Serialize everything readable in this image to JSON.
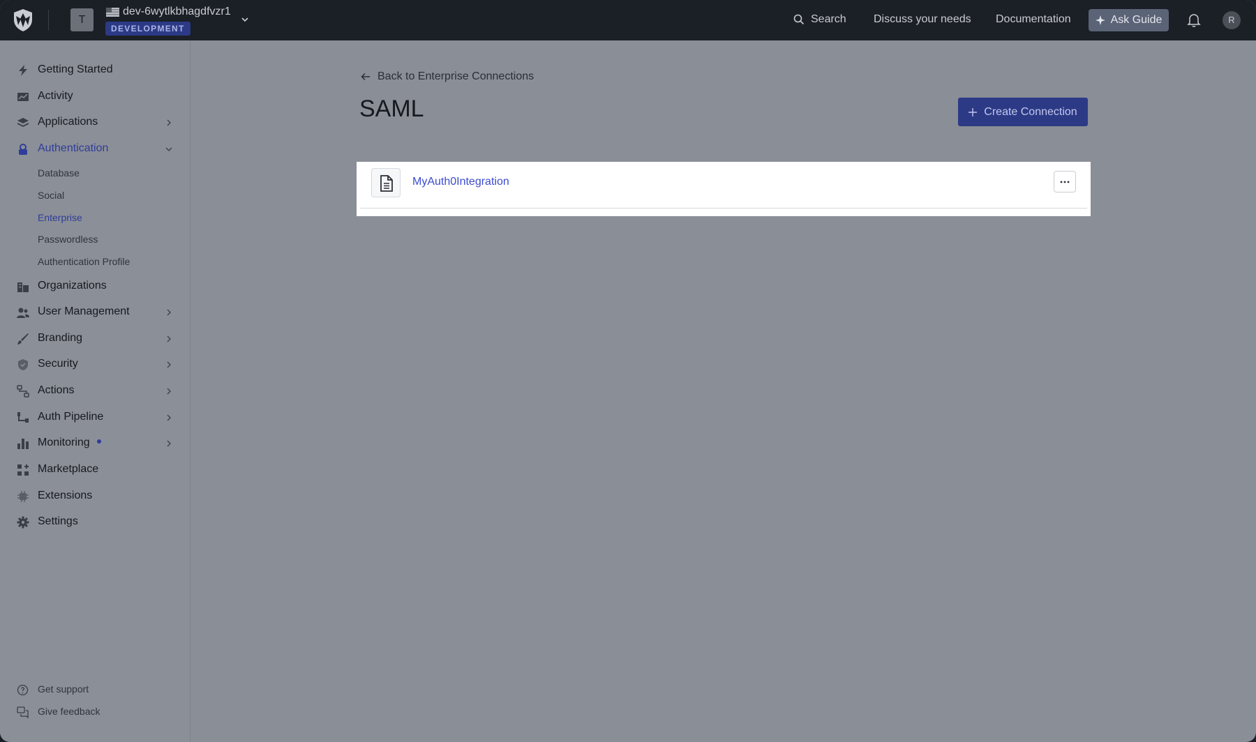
{
  "header": {
    "tenant_initial": "T",
    "tenant_name": "dev-6wytlkbhagdfvzr1",
    "environment_badge": "DEVELOPMENT",
    "search_label": "Search",
    "discuss_label": "Discuss your needs",
    "docs_label": "Documentation",
    "ask_guide_label": "Ask Guide",
    "user_initial": "R"
  },
  "sidebar": {
    "items": [
      {
        "label": "Getting Started",
        "icon": "bolt-icon"
      },
      {
        "label": "Activity",
        "icon": "activity-chart-icon"
      },
      {
        "label": "Applications",
        "icon": "layers-icon"
      },
      {
        "label": "Authentication",
        "icon": "authentication-icon"
      },
      {
        "label": "Organizations",
        "icon": "building-icon"
      },
      {
        "label": "User Management",
        "icon": "users-icon"
      },
      {
        "label": "Branding",
        "icon": "brush-icon"
      },
      {
        "label": "Security",
        "icon": "shield-icon"
      },
      {
        "label": "Actions",
        "icon": "flow-icon"
      },
      {
        "label": "Auth Pipeline",
        "icon": "pipeline-icon"
      },
      {
        "label": "Monitoring",
        "icon": "bar-chart-icon"
      },
      {
        "label": "Marketplace",
        "icon": "grid-plus-icon"
      },
      {
        "label": "Extensions",
        "icon": "chip-icon"
      },
      {
        "label": "Settings",
        "icon": "gear-icon"
      }
    ],
    "auth_subitems": [
      "Database",
      "Social",
      "Enterprise",
      "Passwordless",
      "Authentication Profile"
    ],
    "footer": [
      {
        "label": "Get support",
        "icon": "help-circle-icon"
      },
      {
        "label": "Give feedback",
        "icon": "feedback-icon"
      }
    ]
  },
  "main": {
    "back_link": "Back to Enterprise Connections",
    "title": "SAML",
    "create_button": "Create Connection",
    "connections": [
      {
        "name": "MyAuth0Integration"
      }
    ]
  },
  "colors": {
    "accent": "#2c3a86",
    "link": "#3b4bd0",
    "topbar": "#1b1f26",
    "overlay_background": "#8a8e96"
  }
}
